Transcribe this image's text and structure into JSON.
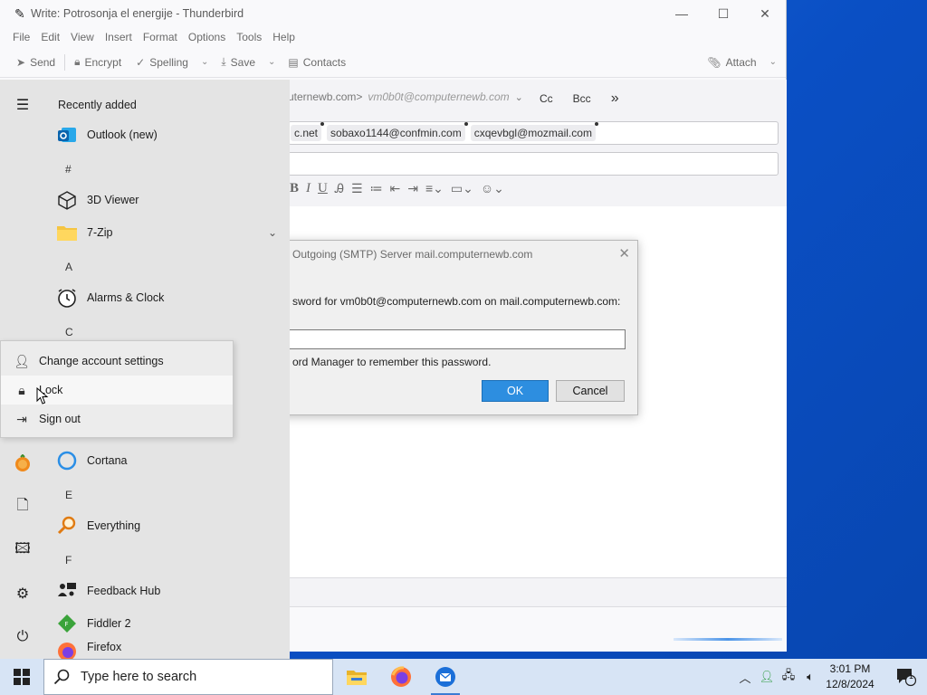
{
  "window": {
    "title": "Write: Potrosonja el energije - Thunderbird",
    "menu": [
      "File",
      "Edit",
      "View",
      "Insert",
      "Format",
      "Options",
      "Tools",
      "Help"
    ],
    "toolbar": {
      "send": "Send",
      "encrypt": "Encrypt",
      "spelling": "Spelling",
      "save": "Save",
      "contacts": "Contacts",
      "attach": "Attach"
    }
  },
  "compose": {
    "from_address": "uternewb.com>",
    "from_identity": "vm0b0t@computernewb.com",
    "cc": "Cc",
    "bcc": "Bcc",
    "more": "»",
    "recipients": [
      "c.net",
      "sobaxo1144@confmin.com",
      "cxqevbgl@mozmail.com"
    ]
  },
  "dialog": {
    "title": "Outgoing (SMTP) Server mail.computernewb.com",
    "message": "sword for vm0b0t@computernewb.com on mail.computernewb.com:",
    "checkbox_label": "ord Manager to remember this password.",
    "ok": "OK",
    "cancel": "Cancel"
  },
  "start_menu": {
    "recently_added": "Recently added",
    "apps": {
      "outlook": "Outlook (new)",
      "hash": "#",
      "viewer3d": "3D Viewer",
      "zip": "7-Zip",
      "letter_a": "A",
      "alarms": "Alarms & Clock",
      "letter_c": "C",
      "cortana": "Cortana",
      "letter_e": "E",
      "everything": "Everything",
      "letter_f": "F",
      "feedback": "Feedback Hub",
      "fiddler": "Fiddler 2",
      "firefox": "Firefox"
    },
    "account_menu": {
      "change": "Change account settings",
      "lock": "Lock",
      "signout": "Sign out"
    }
  },
  "taskbar": {
    "search_placeholder": "Type here to search",
    "time": "3:01 PM",
    "date": "12/8/2024",
    "notification_count": "1"
  }
}
